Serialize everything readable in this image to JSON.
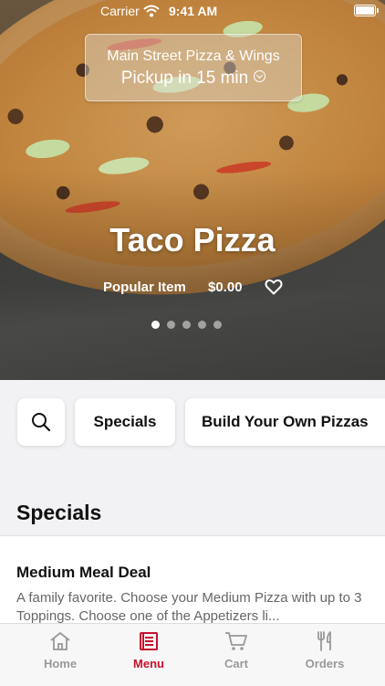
{
  "status_bar": {
    "carrier": "Carrier",
    "time": "9:41 AM"
  },
  "store": {
    "name": "Main Street Pizza & Wings",
    "pickup": "Pickup in 15 min"
  },
  "hero": {
    "title": "Taco Pizza",
    "tag": "Popular Item",
    "price": "$0.00",
    "carousel_total": 5,
    "carousel_active": 1
  },
  "chips": {
    "search_icon": "search-icon",
    "specials": "Specials",
    "build": "Build Your Own Pizzas"
  },
  "section": {
    "title": "Specials",
    "items": [
      {
        "name": "Medium Meal Deal",
        "description": "A family favorite.  Choose your Medium Pizza with up to 3 Toppings.  Choose one of the Appetizers li..."
      }
    ]
  },
  "tabbar": {
    "items": [
      {
        "label": "Home",
        "icon": "home-icon"
      },
      {
        "label": "Menu",
        "icon": "menu-icon",
        "active": true
      },
      {
        "label": "Cart",
        "icon": "cart-icon"
      },
      {
        "label": "Orders",
        "icon": "utensils-icon"
      }
    ]
  },
  "colors": {
    "accent": "#c8102e"
  }
}
